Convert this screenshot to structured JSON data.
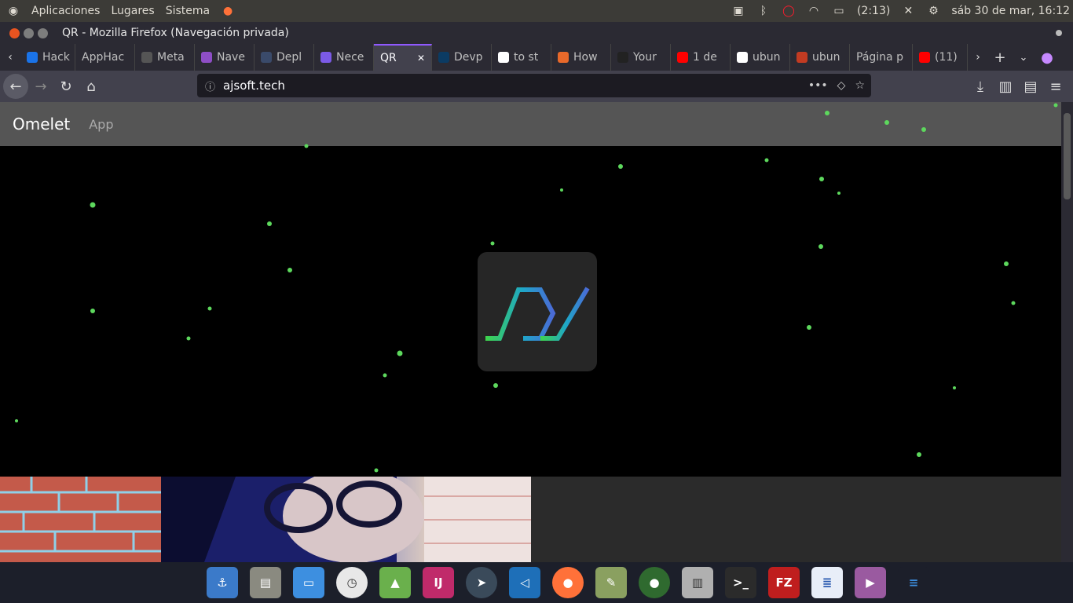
{
  "top_panel": {
    "menu": [
      "Aplicaciones",
      "Lugares",
      "Sistema"
    ],
    "battery": "(2:13)",
    "clock": "sáb 30 de mar, 16:12"
  },
  "window": {
    "title": "QR - Mozilla Firefox (Navegación privada)"
  },
  "tabs": [
    {
      "label": "Hack",
      "icon": "drive-icon",
      "color": "#1a73e8"
    },
    {
      "label": "AppHac",
      "icon": "none",
      "color": "#2b2a33"
    },
    {
      "label": "Meta",
      "icon": "code-icon",
      "color": "#555555"
    },
    {
      "label": "Nave",
      "icon": "mask-icon",
      "color": "#8e4ec6"
    },
    {
      "label": "Depl",
      "icon": "doc-icon",
      "color": "#3a4a6a"
    },
    {
      "label": "Nece",
      "icon": "list-icon",
      "color": "#7b5ae6"
    },
    {
      "label": "QR",
      "icon": "none",
      "color": "#42414d",
      "active": true
    },
    {
      "label": "Devp",
      "icon": "d-icon",
      "color": "#0b3b63"
    },
    {
      "label": "to st",
      "icon": "google-icon",
      "color": "#ffffff"
    },
    {
      "label": "How",
      "icon": "tumblr-icon",
      "color": "#e8692a"
    },
    {
      "label": "Your",
      "icon": "github-icon",
      "color": "#222222"
    },
    {
      "label": "1 de",
      "icon": "youtube-icon",
      "color": "#ff0000"
    },
    {
      "label": "ubun",
      "icon": "google-icon",
      "color": "#ffffff"
    },
    {
      "label": "ubun",
      "icon": "stack-icon",
      "color": "#c23b22"
    },
    {
      "label": "Página p",
      "icon": "none",
      "color": "#2b2a33"
    },
    {
      "label": "(11)",
      "icon": "youtube-icon",
      "color": "#ff0000"
    }
  ],
  "nav": {
    "url": "ajsoft.tech"
  },
  "site": {
    "brand": "Omelet",
    "nav_link": "App"
  },
  "colors": {
    "particle": "#5dd85d",
    "logo_green": "#3fd54a",
    "logo_blue": "#4a6bd6"
  }
}
